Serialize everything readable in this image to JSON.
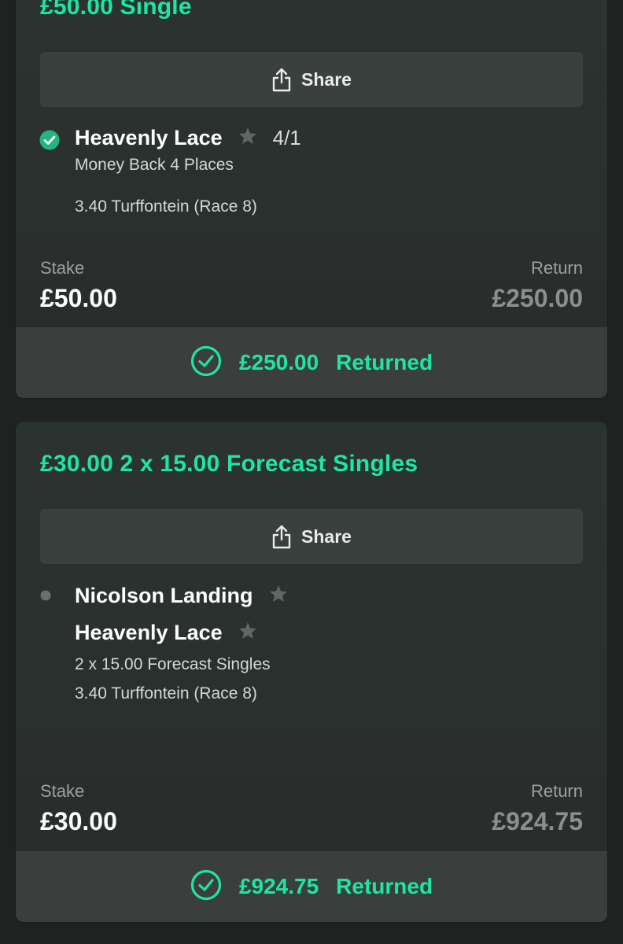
{
  "bets": [
    {
      "title": "£50.00 Single",
      "share_label": "Share",
      "selections": [
        {
          "runner": "Heavenly Lace",
          "odds": "4/1",
          "status": "won"
        }
      ],
      "details": [
        "Money Back 4 Places",
        "3.40 Turffontein (Race 8)"
      ],
      "stake_label": "Stake",
      "stake": "£50.00",
      "return_label": "Return",
      "return": "£250.00",
      "returned_amount": "£250.00",
      "returned_label": "Returned"
    },
    {
      "title": "£30.00 2 x 15.00 Forecast Singles",
      "share_label": "Share",
      "selections": [
        {
          "runner": "Nicolson Landing",
          "status": "settled"
        },
        {
          "runner": "Heavenly Lace"
        }
      ],
      "details": [
        "2 x 15.00 Forecast Singles",
        "3.40 Turffontein (Race 8)"
      ],
      "stake_label": "Stake",
      "stake": "£30.00",
      "return_label": "Return",
      "return": "£924.75",
      "returned_amount": "£924.75",
      "returned_label": "Returned"
    }
  ],
  "colors": {
    "accent": "#1ee6a0",
    "background": "#1f2221",
    "card": "#2a302e",
    "button": "#3a403e",
    "muted": "#8a908d"
  },
  "icons": [
    "share-icon",
    "check-circle-icon",
    "star-icon",
    "status-dot-icon",
    "returned-check-icon"
  ]
}
